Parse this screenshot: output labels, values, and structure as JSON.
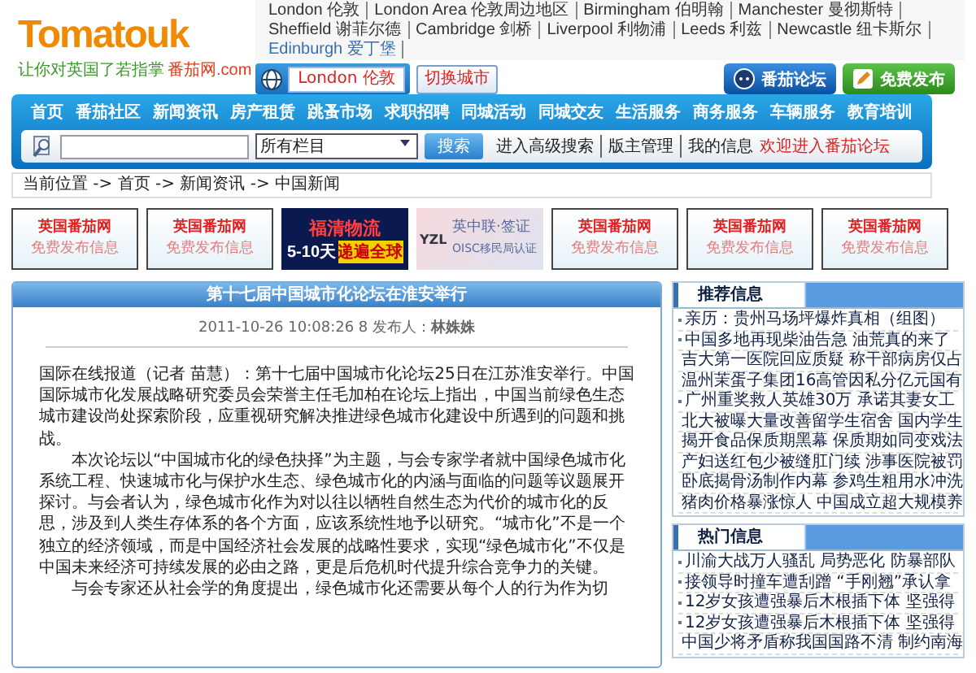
{
  "header": {
    "logo": "Tomatouk",
    "tagline": "让你对英国了若指掌",
    "site_name": "番茄网.com",
    "cities": [
      {
        "label": "London 伦敦",
        "selected": false
      },
      {
        "label": "London Area 伦敦周边地区",
        "selected": false
      },
      {
        "label": "Birmingham 伯明翰",
        "selected": false
      },
      {
        "label": "Manchester 曼彻斯特",
        "selected": false
      },
      {
        "label": "Sheffield 谢菲尔德",
        "selected": false
      },
      {
        "label": "Cambridge 剑桥",
        "selected": false
      },
      {
        "label": "Liverpool 利物浦",
        "selected": false
      },
      {
        "label": "Leeds 利兹",
        "selected": false
      },
      {
        "label": "Newcastle 纽卡斯尔",
        "selected": false
      },
      {
        "label": "Edinburgh 爱丁堡",
        "selected": true
      }
    ],
    "city_field": "London 伦敦",
    "switch_city": "切换城市",
    "forum_button": "番茄论坛",
    "post_button": "免费发布"
  },
  "nav": {
    "items": [
      "首页",
      "番茄社区",
      "新闻资讯",
      "房产租赁",
      "跳蚤市场",
      "求职招聘",
      "同城活动",
      "同城交友",
      "生活服务",
      "商务服务",
      "车辆服务",
      "教育培训"
    ]
  },
  "search": {
    "scope": "所有栏目",
    "button": "搜索",
    "links": [
      {
        "label": "进入高级搜索",
        "kind": "plain"
      },
      {
        "label": "版主管理",
        "kind": "plain"
      },
      {
        "label": "我的信息",
        "kind": "plain"
      },
      {
        "label": "欢迎进入番茄论坛",
        "kind": "highlight"
      }
    ]
  },
  "breadcrumb": "当前位置 -> 首页 -> 新闻资讯 -> 中国新闻",
  "ads": [
    {
      "kind": "house",
      "title": "英国番茄网",
      "subtitle": "免费发布信息"
    },
    {
      "kind": "house",
      "title": "英国番茄网",
      "subtitle": "免费发布信息"
    },
    {
      "kind": "logistics",
      "title": "福清物流",
      "subtitle": "5-10天",
      "highlight": "递遍全球"
    },
    {
      "kind": "visa",
      "logo": "YZL",
      "title": "英中联·签证",
      "subtitle": "OISC移民局认证"
    },
    {
      "kind": "house",
      "title": "英国番茄网",
      "subtitle": "免费发布信息"
    },
    {
      "kind": "house",
      "title": "英国番茄网",
      "subtitle": "免费发布信息"
    },
    {
      "kind": "house",
      "title": "英国番茄网",
      "subtitle": "免费发布信息"
    }
  ],
  "article": {
    "title": "第十七届中国城市化论坛在淮安举行",
    "meta": "2011-10-26 10:08:26 8 发布人：**林姝姝**",
    "paragraphs": [
      "国际在线报道（记者 苗慧）：第十七届中国城市化论坛25日在江苏淮安举行。中国国际城市化发展战略研究委员会荣誉主任毛加柏在论坛上指出，中国当前绿色生态城市建设尚处探索阶段，应重视研究解决推进绿色城市化建设中所遇到的问题和挑战。",
      "本次论坛以“中国城市化的绿色抉择”为主题，与会专家学者就中国绿色城市化系统工程、快速城市化与保护水生态、绿色城市化的内涵与面临的问题等议题展开探讨。与会者认为，绿色城市化作为对以往以牺牲自然生态为代价的城市化的反思，涉及到人类生存体系的各个方面，应该系统性地予以研究。“城市化”不是一个独立的经济领域，而是中国经济社会发展的战略性要求，实现“绿色城市化”不仅是中国未来经济可持续发展的必由之路，更是后危机时代提升综合竞争力的关键。",
      "与会专家还从社会学的角度提出，绿色城市化还需要从每个人的行为作为切"
    ]
  },
  "sidebar": [
    {
      "title": "推荐信息",
      "items": [
        "亲历：贵州马场坪爆炸真相（组图）",
        "中国多地再现柴油告急 油荒真的来了",
        "吉大第一医院回应质疑 称干部病房仅占",
        "温州茉蛋子集团16高管因私分亿元国有",
        "广州重奖救人英雄30万 承诺其妻女工",
        "北大被曝大量改善留学生宿舍 国内学生",
        "揭开食品保质期黑幕 保质期如同变戏法",
        "产妇送红包少被缝肛门续 涉事医院被罚",
        "卧底揭骨汤制作内幕 参鸡生粗用水冲洗",
        "猪肉价格暴涨惊人 中国成立超大规模养"
      ]
    },
    {
      "title": "热门信息",
      "items": [
        "川渝大战万人骚乱 局势恶化 防暴部队",
        "接领导时撞车遭刮蹭 “手刚翘”承认拿",
        "12岁女孩遭强暴后木根插下体 坚强得",
        "12岁女孩遭强暴后木根插下体 坚强得",
        "中国少将矛盾称我国国路不清 制约南海"
      ]
    }
  ]
}
